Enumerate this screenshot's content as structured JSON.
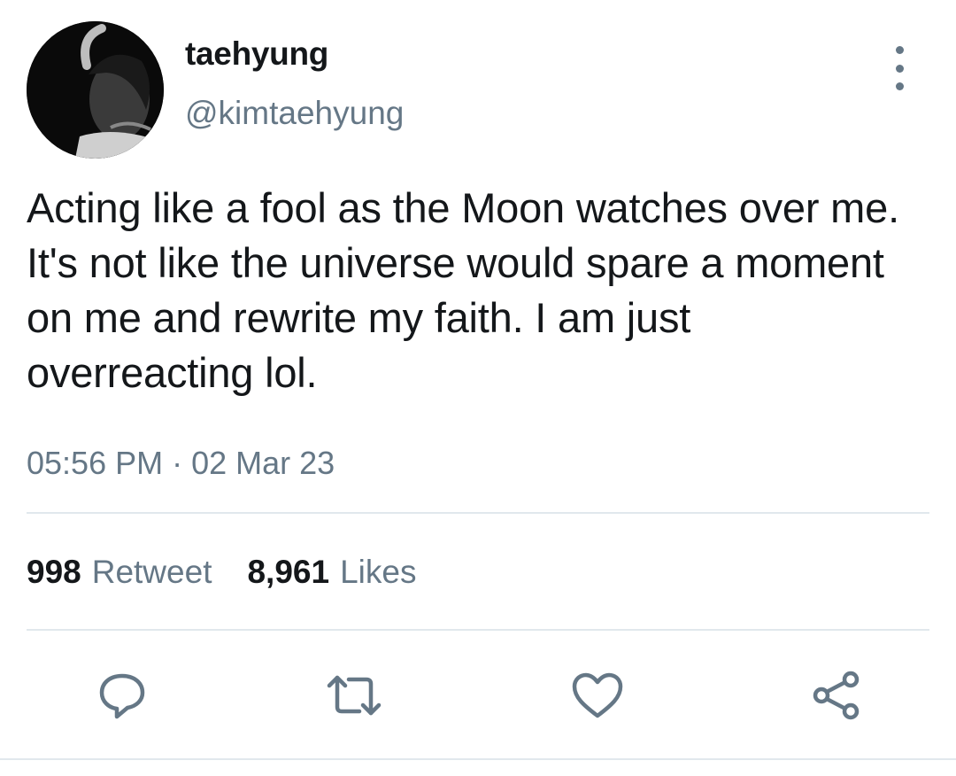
{
  "tweet": {
    "display_name": "taehyung",
    "handle": "@kimtaehyung",
    "text": "Acting like a fool as the Moon watches over me. It's not like the universe would spare a moment on me and rewrite my faith. I am just overreacting lol.",
    "timestamp": "05:56 PM · 02 Mar 23"
  },
  "stats": {
    "retweet_count": "998",
    "retweet_label": "Retweet",
    "likes_count": "8,961",
    "likes_label": "Likes"
  },
  "icons": {
    "more": "more-vertical-icon",
    "reply": "reply-icon",
    "retweet": "retweet-icon",
    "like": "heart-icon",
    "share": "share-icon"
  },
  "colors": {
    "text_primary": "#14171a",
    "text_secondary": "#657786",
    "divider": "#e1e8ed",
    "icon": "#657786"
  }
}
